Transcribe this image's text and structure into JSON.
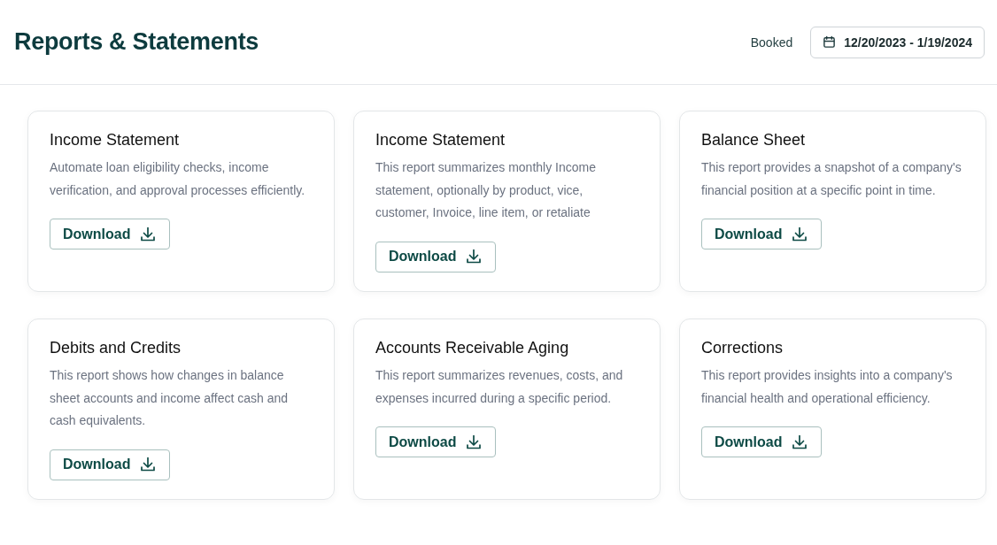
{
  "header": {
    "title": "Reports & Statements",
    "filter_label": "Booked",
    "date_range": "12/20/2023 - 1/19/2024"
  },
  "reports": [
    {
      "title": "Income Statement",
      "description": "Automate loan eligibility checks, income verification, and approval processes efficiently.",
      "button": "Download"
    },
    {
      "title": "Income Statement",
      "description": "This report summarizes monthly Income statement, optionally by product, vice, customer, Invoice, line item, or retaliate",
      "button": "Download"
    },
    {
      "title": "Balance Sheet",
      "description": "This report provides a snapshot of a company's financial position at a specific point in time.",
      "button": "Download"
    },
    {
      "title": "Debits and Credits",
      "description": "This report shows how changes in balance sheet accounts and income affect cash and cash equivalents.",
      "button": "Download"
    },
    {
      "title": "Accounts Receivable Aging",
      "description": "This report summarizes revenues, costs, and expenses incurred during a specific period.",
      "button": "Download"
    },
    {
      "title": "Corrections",
      "description": "This report provides insights into a company's financial health and operational efficiency.",
      "button": "Download"
    }
  ]
}
